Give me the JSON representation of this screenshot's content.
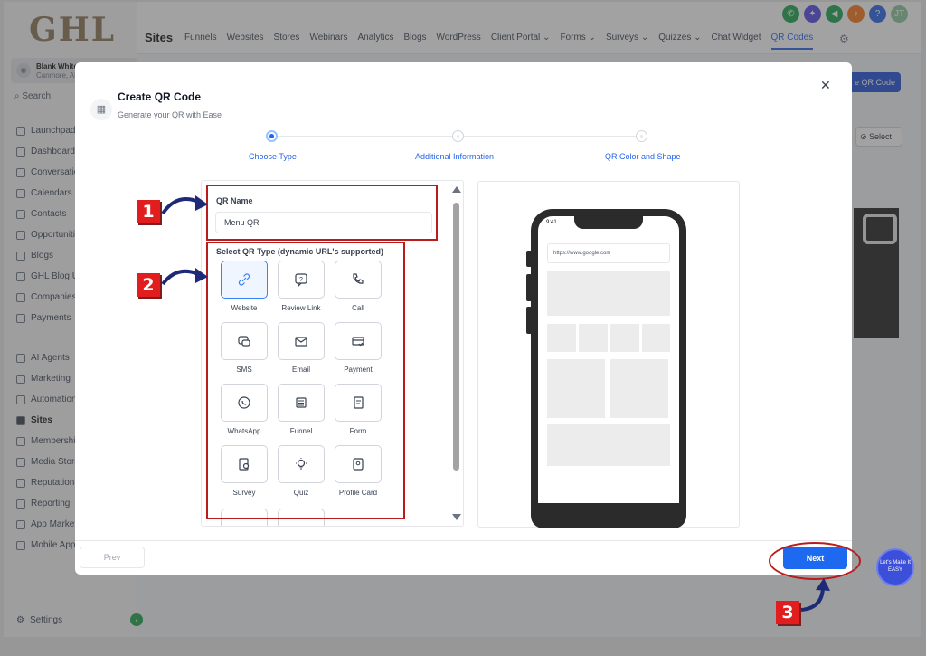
{
  "app": {
    "logo": "GHL",
    "account": {
      "name": "Blank WhiteLa",
      "location": "Canmore, Alb"
    },
    "search_label": "Search",
    "sidebar": [
      {
        "label": "Launchpad"
      },
      {
        "label": "Dashboard"
      },
      {
        "label": "Conversatio"
      },
      {
        "label": "Calendars"
      },
      {
        "label": "Contacts"
      },
      {
        "label": "Opportunitie"
      },
      {
        "label": "Blogs"
      },
      {
        "label": "GHL Blog U"
      },
      {
        "label": "Companies"
      },
      {
        "label": "Payments"
      },
      {
        "label": "AI Agents"
      },
      {
        "label": "Marketing"
      },
      {
        "label": "Automation"
      },
      {
        "label": "Sites"
      },
      {
        "label": "Membership"
      },
      {
        "label": "Media Stora"
      },
      {
        "label": "Reputation"
      },
      {
        "label": "Reporting"
      },
      {
        "label": "App Market"
      },
      {
        "label": "Mobile App"
      }
    ],
    "settings_label": "Settings",
    "section_title": "Sites",
    "top_nav": [
      "Funnels",
      "Websites",
      "Stores",
      "Webinars",
      "Analytics",
      "Blogs",
      "WordPress",
      "Client Portal ⌄",
      "Forms ⌄",
      "Surveys ⌄",
      "Quizzes ⌄",
      "Chat Widget",
      "QR Codes"
    ],
    "top_nav_active_index": 12,
    "user_initials": "JT",
    "bg_create_label": "e QR Code",
    "bg_select_label": "Select"
  },
  "modal": {
    "title": "Create QR Code",
    "subtitle": "Generate your QR with Ease",
    "steps": [
      {
        "label": "Choose Type",
        "state": "active"
      },
      {
        "label": "Additional Information",
        "state": "inactive"
      },
      {
        "label": "QR Color and Shape",
        "state": "inactive"
      }
    ],
    "qr_name_label": "QR Name",
    "qr_name_value": "Menu QR",
    "type_label": "Select QR Type (dynamic URL's supported)",
    "types": [
      {
        "label": "Website",
        "icon": "link-icon",
        "selected": true
      },
      {
        "label": "Review Link",
        "icon": "review-icon",
        "selected": false
      },
      {
        "label": "Call",
        "icon": "phone-icon",
        "selected": false
      },
      {
        "label": "SMS",
        "icon": "sms-icon",
        "selected": false
      },
      {
        "label": "Email",
        "icon": "mail-icon",
        "selected": false
      },
      {
        "label": "Payment",
        "icon": "card-icon",
        "selected": false
      },
      {
        "label": "WhatsApp",
        "icon": "whatsapp-icon",
        "selected": false
      },
      {
        "label": "Funnel",
        "icon": "funnel-icon",
        "selected": false
      },
      {
        "label": "Form",
        "icon": "form-icon",
        "selected": false
      },
      {
        "label": "Survey",
        "icon": "survey-icon",
        "selected": false
      },
      {
        "label": "Quiz",
        "icon": "bulb-icon",
        "selected": false
      },
      {
        "label": "Profile Card",
        "icon": "profile-card-icon",
        "selected": false
      }
    ],
    "preview": {
      "time": "9:41",
      "url": "https://www.google.com"
    },
    "prev_label": "Prev",
    "next_label": "Next"
  },
  "annotations": [
    "1",
    "2",
    "3"
  ],
  "watermark": "Let's Make It EASY",
  "colors": {
    "accent": "#1d6af0",
    "annotation_red": "#b91c1c",
    "arrow_navy": "#1e2a78"
  }
}
